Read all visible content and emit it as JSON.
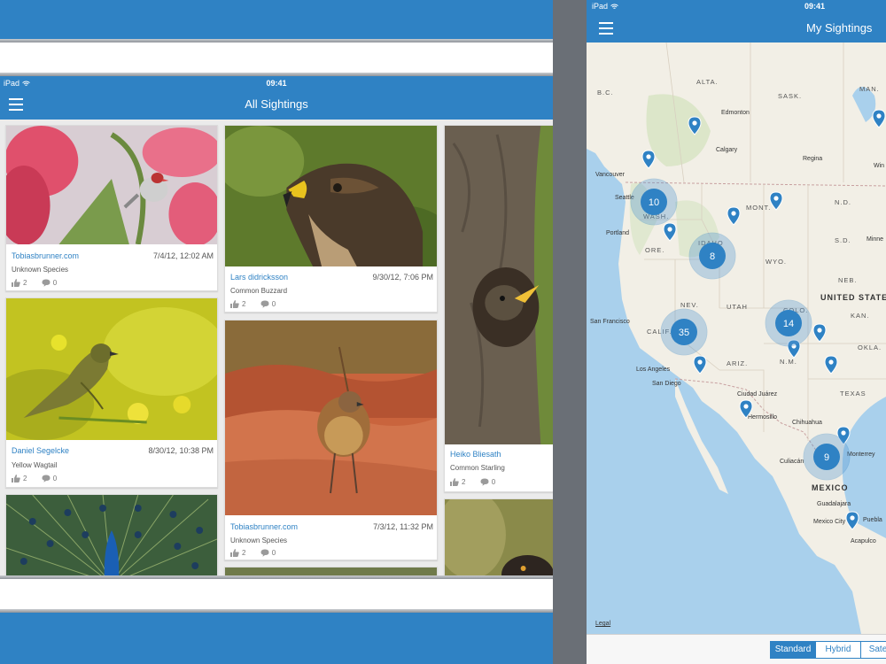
{
  "left": {
    "status": {
      "device": "iPad",
      "time": "09:41"
    },
    "title": "All Sightings",
    "cards": [
      {
        "author": "Tobiasbrunner.com",
        "date": "7/4/12, 12:02 AM",
        "species": "Unknown Species",
        "likes": "2",
        "comments": "0"
      },
      {
        "author": "Daniel Segelcke",
        "date": "8/30/12, 10:38 PM",
        "species": "Yellow Wagtail",
        "likes": "2",
        "comments": "0"
      },
      {
        "author": "Lars didricksson",
        "date": "9/30/12, 7:06 PM",
        "species": "Common Buzzard",
        "likes": "2",
        "comments": "0"
      },
      {
        "author": "Tobiasbrunner.com",
        "date": "7/3/12, 11:32 PM",
        "species": "Unknown Species",
        "likes": "2",
        "comments": "0"
      },
      {
        "author": "Heiko Bliesath",
        "date": "",
        "species": "Common Starling",
        "likes": "2",
        "comments": "0"
      }
    ]
  },
  "right": {
    "status": {
      "device": "iPad",
      "time": "09:41"
    },
    "title": "My Sightings",
    "map": {
      "regions": [
        "B.C.",
        "ALTA.",
        "SASK.",
        "MAN.",
        "WASH.",
        "MONT.",
        "N.D.",
        "IDAHO",
        "ORE.",
        "WYO.",
        "S.D.",
        "NEV.",
        "UTAH",
        "COLO.",
        "NEB.",
        "CALIF.",
        "ARIZ.",
        "N.M.",
        "KAN.",
        "OKLA.",
        "TEXAS"
      ],
      "countries": [
        "UNITED STATE",
        "MEXICO"
      ],
      "cities": [
        "Edmonton",
        "Calgary",
        "Regina",
        "Vancouver",
        "Seattle",
        "Portland",
        "Minne",
        "Win",
        "San Francisco",
        "Los Angeles",
        "San Diego",
        "Ciudad Juárez",
        "Hermosillo",
        "Chihuahua",
        "Culiacán",
        "Monterrey",
        "Guadalajara",
        "Mexico City",
        "Puebla",
        "Acapulco"
      ],
      "clusters": [
        "10",
        "8",
        "35",
        "14",
        "9"
      ],
      "legal": "Legal"
    },
    "map_types": [
      "Standard",
      "Hybrid",
      "Sate"
    ],
    "colors": {
      "brand_blue": "#2f82c4",
      "water": "#a9d0ec",
      "land": "#f2efe6"
    }
  }
}
